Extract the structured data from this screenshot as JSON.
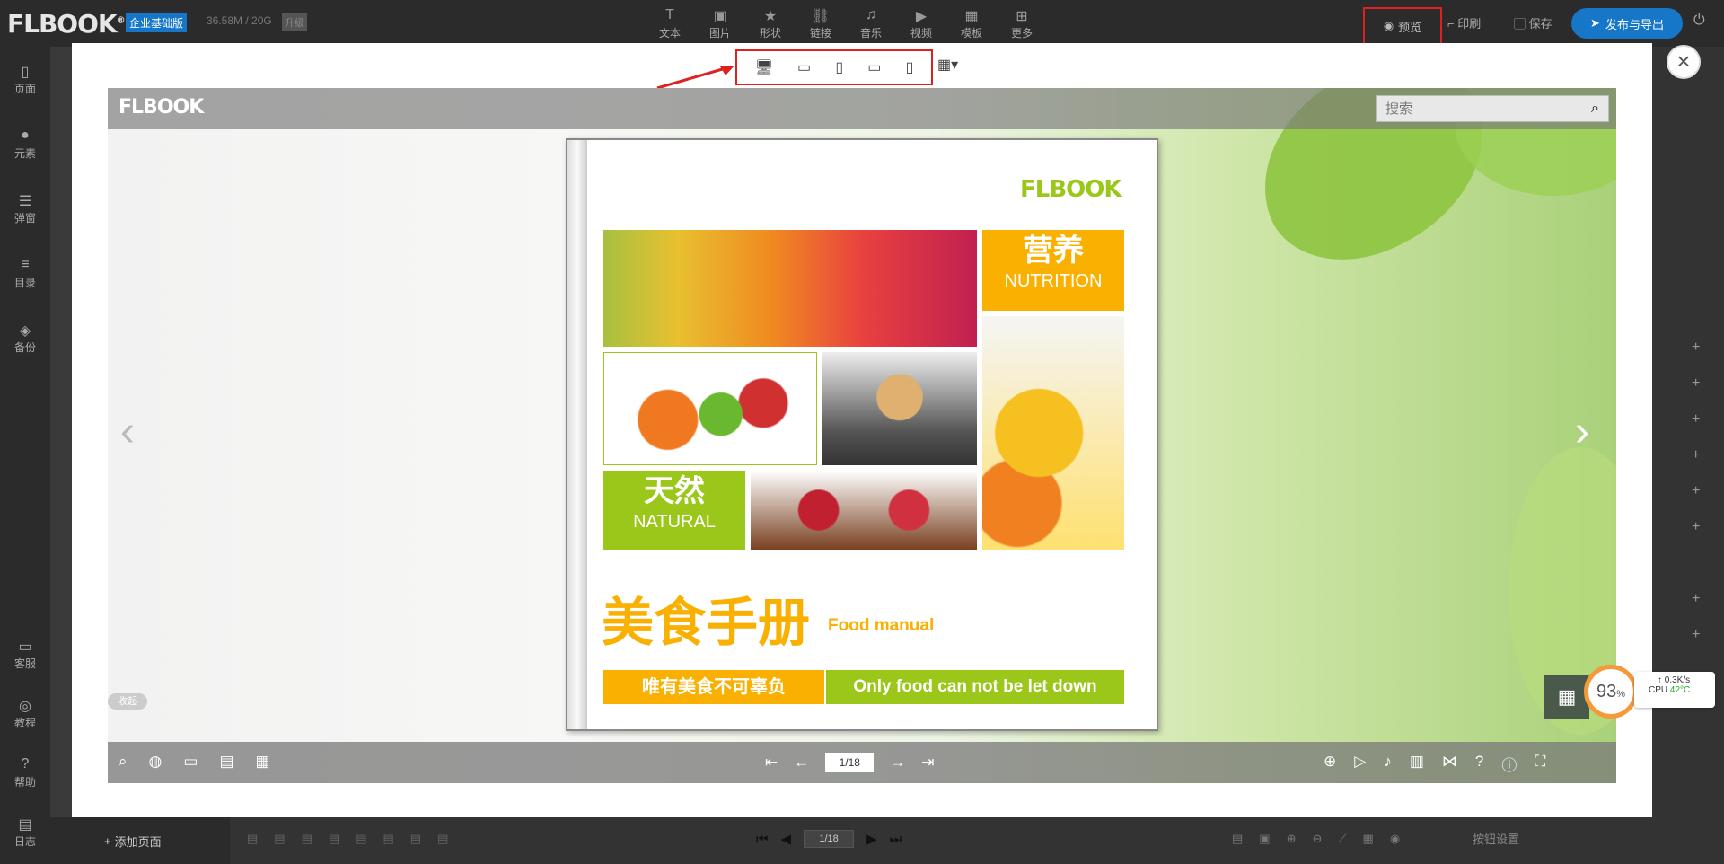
{
  "app": {
    "logo": "FLBOOK",
    "edition": "企业基础版",
    "storage": "36.58M / 20G",
    "upgrade": "升级"
  },
  "toolbar": {
    "items": [
      {
        "icon": "text-icon",
        "label": "文本"
      },
      {
        "icon": "image-icon",
        "label": "图片"
      },
      {
        "icon": "shape-icon",
        "label": "形状"
      },
      {
        "icon": "link-icon",
        "label": "链接"
      },
      {
        "icon": "music-icon",
        "label": "音乐"
      },
      {
        "icon": "video-icon",
        "label": "视频"
      },
      {
        "icon": "template-icon",
        "label": "模板"
      },
      {
        "icon": "more-icon",
        "label": "更多"
      }
    ]
  },
  "actions": {
    "preview": "预览",
    "print": "印刷",
    "save": "保存",
    "publish": "发布与导出"
  },
  "sidebar": {
    "items": [
      {
        "label": "页面"
      },
      {
        "label": "元素"
      },
      {
        "label": "弹窗"
      },
      {
        "label": "目录"
      },
      {
        "label": "备份"
      },
      {
        "label": "客服"
      },
      {
        "label": "教程"
      },
      {
        "label": "帮助"
      },
      {
        "label": "日志"
      }
    ]
  },
  "bottombar": {
    "add_page": "添加页面",
    "page_indicator": "1/18",
    "button_settings": "按钮设置"
  },
  "viewer": {
    "logo": "FLBOOK",
    "search_placeholder": "搜索",
    "collapse_label": "收起",
    "page_indicator": "1/18"
  },
  "book": {
    "logo": "FLBOOK",
    "nutrition_zh": "营养",
    "nutrition_en": "NUTRITION",
    "natural_zh": "天然",
    "natural_en": "NATURAL",
    "title_zh": "美食手册",
    "title_en": "Food manual",
    "slogan_zh": "唯有美食不可辜负",
    "slogan_en": "Only food can not be let down"
  },
  "system_monitor": {
    "cpu_percent": "93",
    "percent_sign": "%",
    "net_speed": "0.3K/s",
    "cpu_label": "CPU",
    "cpu_temp": "42°C"
  },
  "colors": {
    "accent_orange": "#f9b000",
    "accent_green": "#9bc61a",
    "brand_blue": "#1677c9",
    "highlight_red": "#e02020"
  }
}
